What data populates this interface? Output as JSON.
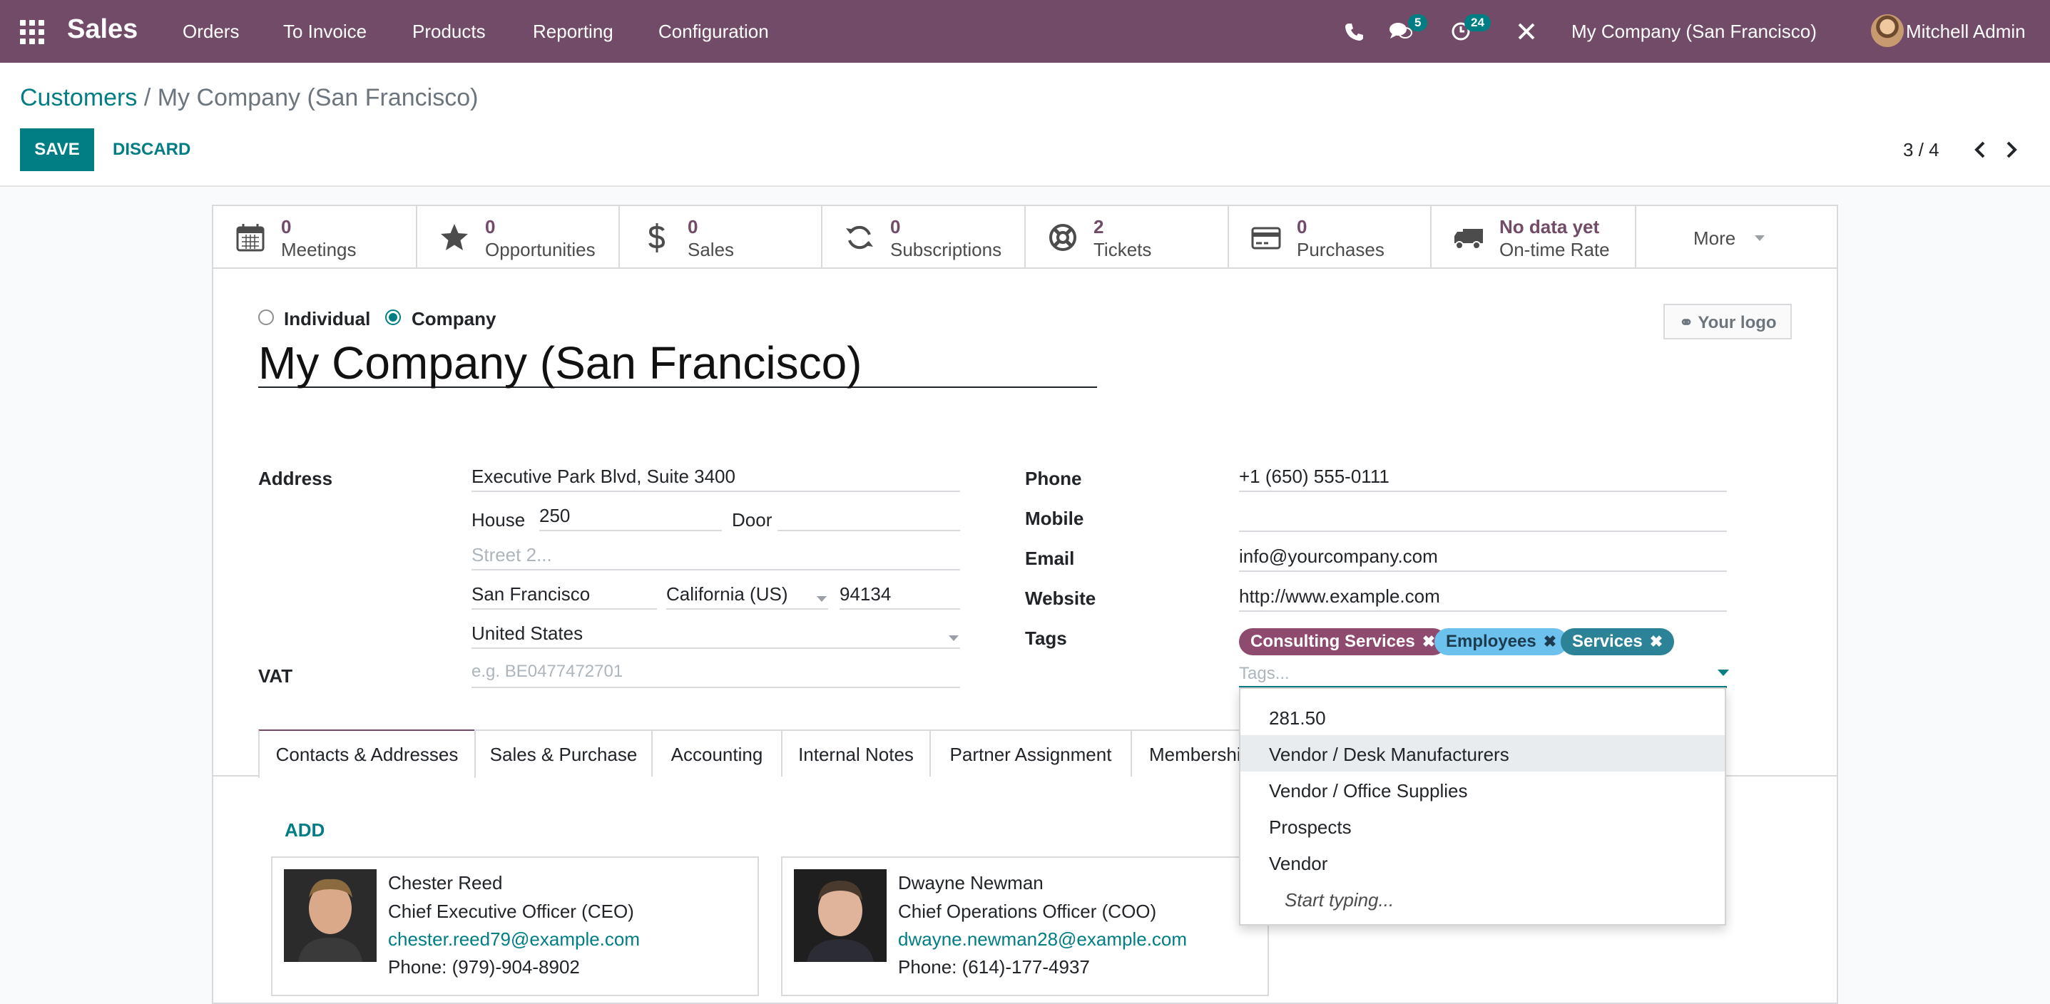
{
  "topbar": {
    "app_name": "Sales",
    "menu": [
      "Orders",
      "To Invoice",
      "Products",
      "Reporting",
      "Configuration"
    ],
    "messages_count": "5",
    "activities_count": "24",
    "company": "My Company (San Francisco)",
    "user": "Mitchell Admin"
  },
  "control": {
    "breadcrumb_parent": "Customers",
    "breadcrumb_sep": "/",
    "breadcrumb_current": "My Company (San Francisco)",
    "save_label": "SAVE",
    "discard_label": "DISCARD",
    "pager": "3 / 4"
  },
  "stat_buttons": [
    {
      "value": "0",
      "label": "Meetings",
      "icon": "calendar-icon"
    },
    {
      "value": "0",
      "label": "Opportunities",
      "icon": "star-icon"
    },
    {
      "value": "0",
      "label": "Sales",
      "icon": "dollar-icon"
    },
    {
      "value": "0",
      "label": "Subscriptions",
      "icon": "refresh-icon"
    },
    {
      "value": "2",
      "label": "Tickets",
      "icon": "life-ring-icon"
    },
    {
      "value": "0",
      "label": "Purchases",
      "icon": "credit-card-icon"
    },
    {
      "value": "No data yet",
      "label": "On-time Rate",
      "icon": "truck-icon"
    }
  ],
  "more_label": "More",
  "company_type": {
    "individual": "Individual",
    "company": "Company",
    "selected": "Company"
  },
  "partner_name": "My Company (San Francisco)",
  "logo_label": "Your logo",
  "address": {
    "label": "Address",
    "street": "Executive Park Blvd, Suite 3400",
    "house_label": "House",
    "house": "250",
    "door_label": "Door",
    "door": "",
    "street2_placeholder": "Street 2...",
    "city": "San Francisco",
    "state": "California (US)",
    "zip": "94134",
    "country": "United States"
  },
  "vat": {
    "label": "VAT",
    "placeholder": "e.g. BE0477472701"
  },
  "contact": {
    "phone_label": "Phone",
    "phone": "+1 (650) 555-0111",
    "mobile_label": "Mobile",
    "mobile": "",
    "email_label": "Email",
    "email": "info@yourcompany.com",
    "website_label": "Website",
    "website": "http://www.example.com",
    "tags_label": "Tags",
    "tags": [
      {
        "name": "Consulting Services",
        "color": "#8e4a6f"
      },
      {
        "name": "Employees",
        "color": "#6cc1ed"
      },
      {
        "name": "Services",
        "color": "#2c8397"
      }
    ],
    "tags_placeholder": "Tags..."
  },
  "tabs": [
    "Contacts & Addresses",
    "Sales & Purchase",
    "Accounting",
    "Internal Notes",
    "Partner Assignment",
    "Membership"
  ],
  "add_label": "ADD",
  "contacts": [
    {
      "name": "Chester Reed",
      "title": "Chief Executive Officer (CEO)",
      "email": "chester.reed79@example.com",
      "phone": "Phone: (979)-904-8902"
    },
    {
      "name": "Dwayne Newman",
      "title": "Chief Operations Officer (COO)",
      "email": "dwayne.newman28@example.com",
      "phone": "Phone: (614)-177-4937"
    }
  ],
  "tag_dropdown": [
    "281.50",
    "Vendor / Desk Manufacturers",
    "Vendor / Office Supplies",
    "Prospects",
    "Vendor",
    "Start typing..."
  ],
  "colors": {
    "brand": "#714b67",
    "accent": "#017e84"
  }
}
